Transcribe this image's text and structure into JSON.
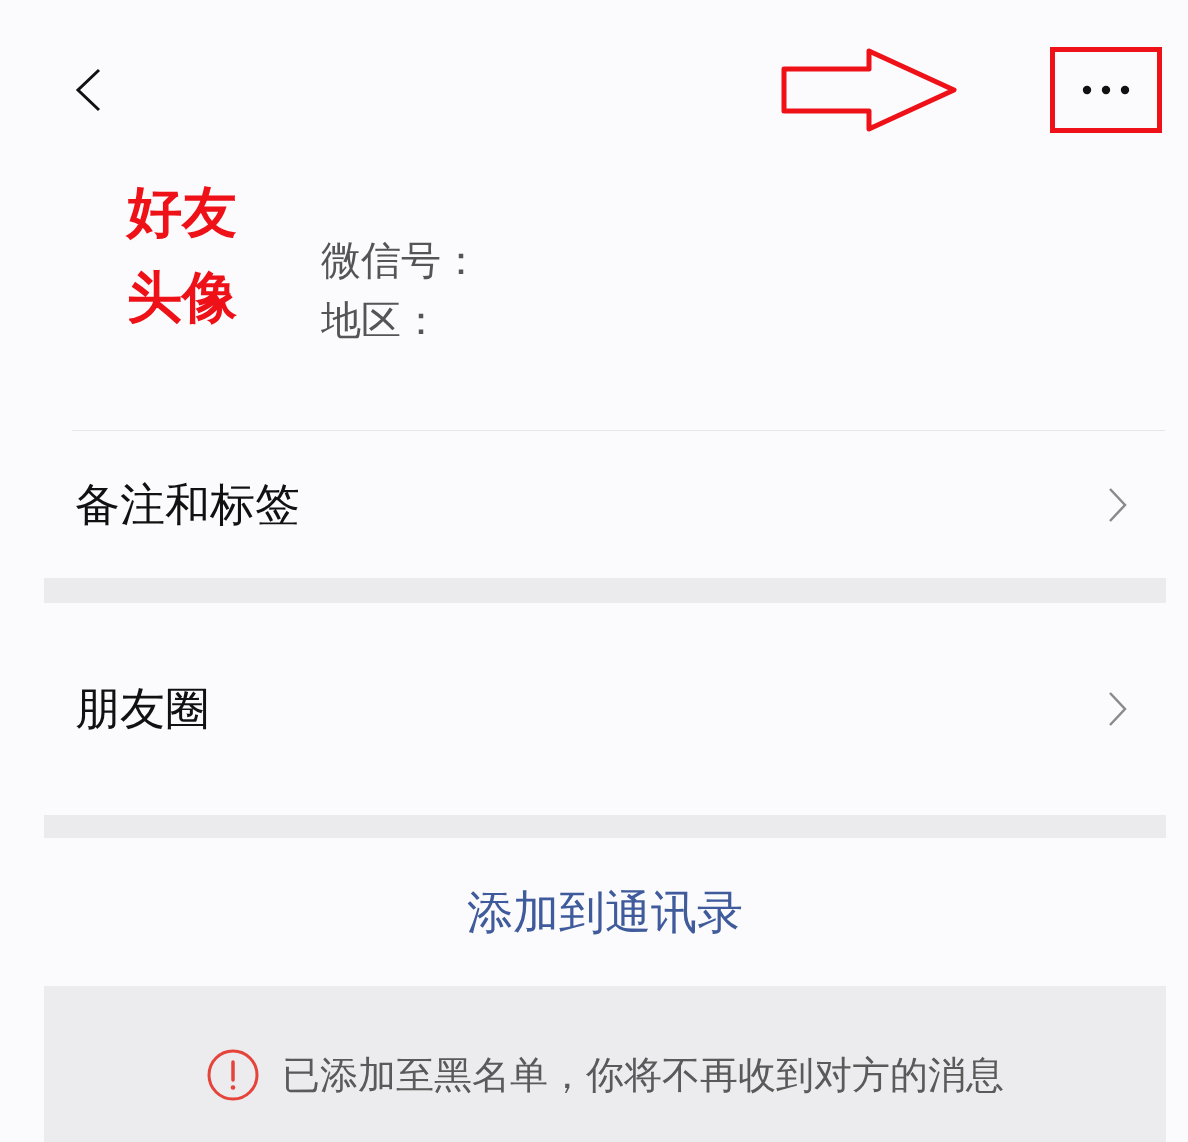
{
  "top_bar": {
    "more_highlighted": true
  },
  "profile": {
    "avatar_label": "好友头像",
    "fields": [
      "微信号：",
      "地区："
    ]
  },
  "menu_items": [
    {
      "label": "备注和标签"
    },
    {
      "label": "朋友圈"
    }
  ],
  "action": {
    "label": "添加到通讯录"
  },
  "notice": {
    "text": "已添加至黑名单，你将不再收到对方的消息"
  }
}
